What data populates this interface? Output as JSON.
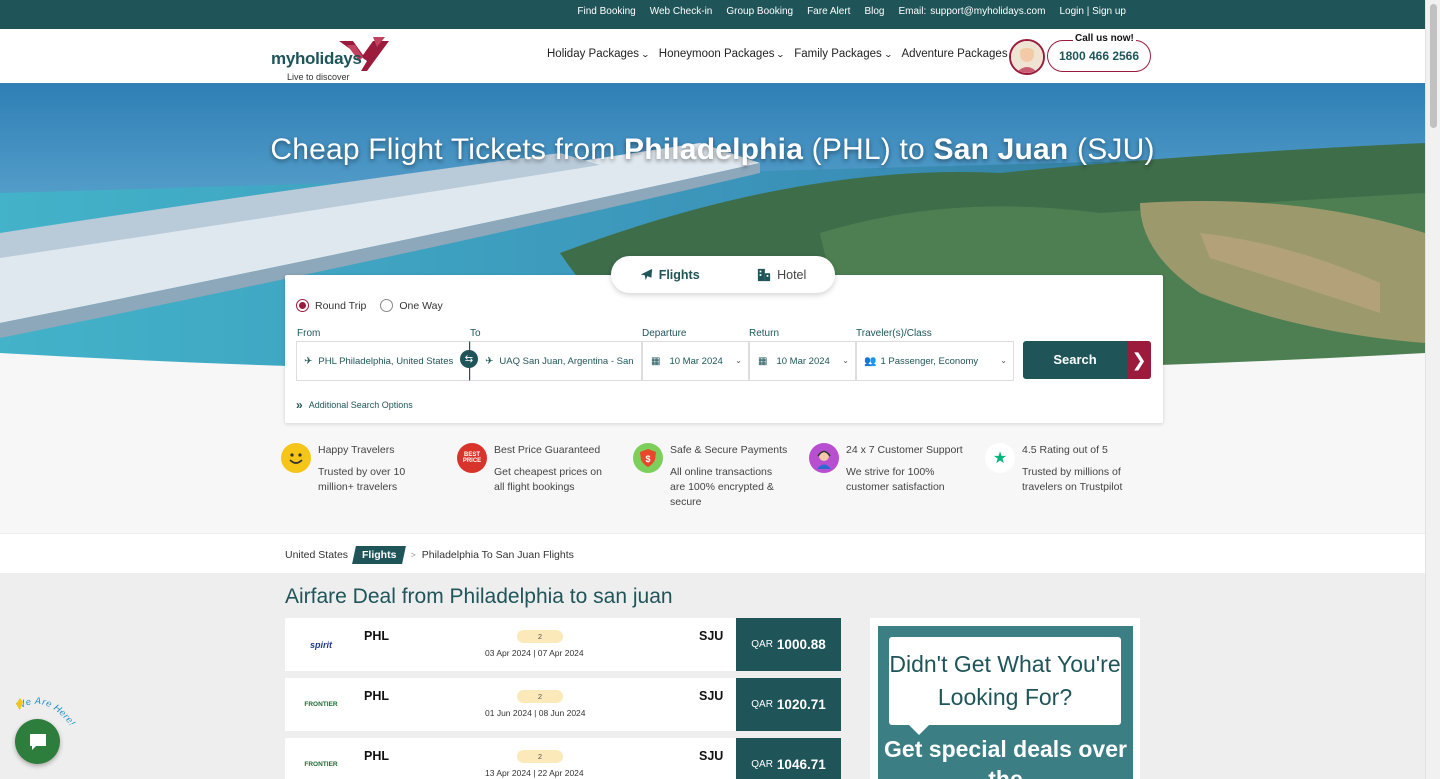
{
  "topbar": {
    "links": [
      "Find Booking",
      "Web Check-in",
      "Group Booking",
      "Fare Alert",
      "Blog"
    ],
    "email_label": "Email:",
    "email": "support@myholidays.com",
    "login": "Login | Sign up"
  },
  "header": {
    "logo_text": "myholidays",
    "logo_tagline": "Live to discover",
    "nav": [
      "Holiday Packages",
      "Honeymoon Packages",
      "Family Packages",
      "Adventure Packages"
    ],
    "call_label": "Call us now!",
    "phone": "1800 466 2566"
  },
  "hero": {
    "title_prefix": "Cheap Flight Tickets from ",
    "origin_city": "Philadelphia",
    "origin_code": " (PHL) to ",
    "dest_city": "San Juan",
    "dest_code": " (SJU)"
  },
  "search": {
    "tabs": [
      {
        "label": "Flights",
        "icon": "plane-icon",
        "active": true
      },
      {
        "label": "Hotel",
        "icon": "hotel-icon",
        "active": false
      }
    ],
    "trip_types": [
      "Round Trip",
      "One Way"
    ],
    "selected_trip": "Round Trip",
    "labels": {
      "from": "From",
      "to": "To",
      "departure": "Departure",
      "return": "Return",
      "travelers": "Traveler(s)/Class"
    },
    "from_value": "PHL Philadelphia, United States",
    "to_value": "UAQ San Juan, Argentina - San",
    "departure_value": "10 Mar 2024",
    "return_value": "10 Mar 2024",
    "travelers_value": "1 Passenger, Economy",
    "search_button": "Search",
    "additional": "Additional Search Options"
  },
  "features": [
    {
      "title": "Happy Travelers",
      "desc": "Trusted by over 10 million+ travelers",
      "icon": "smiley-icon"
    },
    {
      "title": "Best Price Guaranteed",
      "desc": "Get cheapest prices on all flight bookings",
      "icon": "best-price-badge-icon"
    },
    {
      "title": "Safe & Secure Payments",
      "desc": "All online transactions are 100% encrypted & secure",
      "icon": "shield-icon"
    },
    {
      "title": "24 x 7 Customer Support",
      "desc": "We strive for 100% customer satisfaction",
      "icon": "support-agent-icon"
    },
    {
      "title": "4.5 Rating out of 5",
      "desc": "Trusted by millions of travelers on Trustpilot",
      "icon": "trustpilot-star-icon"
    }
  ],
  "breadcrumb": [
    "United States",
    "Flights",
    "Philadelphia To San Juan Flights"
  ],
  "deals_title": "Airfare Deal from Philadelphia to san juan",
  "deals": [
    {
      "airline": "spirit",
      "origin": "PHL",
      "dest": "SJU",
      "stops": "2",
      "dates": "03 Apr 2024   | 07 Apr 2024",
      "currency": "QAR",
      "price": "1000.88"
    },
    {
      "airline": "FRONTIER",
      "origin": "PHL",
      "dest": "SJU",
      "stops": "2",
      "dates": "01 Jun 2024   | 08 Jun 2024",
      "currency": "QAR",
      "price": "1020.71"
    },
    {
      "airline": "FRONTIER",
      "origin": "PHL",
      "dest": "SJU",
      "stops": "2",
      "dates": "13 Apr 2024   | 22 Apr 2024",
      "currency": "QAR",
      "price": "1046.71"
    }
  ],
  "promo": {
    "bubble": "Didn't Get What You're Looking For?",
    "special": "Get special deals over the"
  },
  "chat": {
    "badge": "We Are Here!"
  },
  "colors": {
    "primary": "#1f5559",
    "accent": "#9b1b3c",
    "promo_bg": "#3b7f85"
  }
}
